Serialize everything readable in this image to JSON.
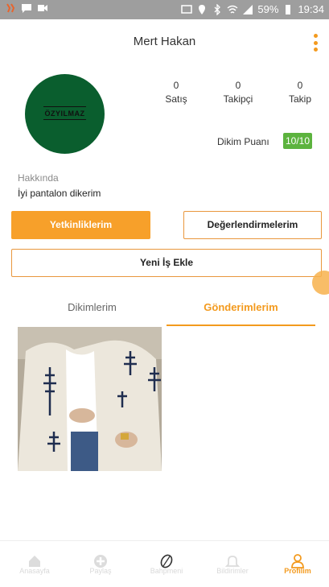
{
  "status_bar": {
    "battery": "59%",
    "time": "19:34"
  },
  "header": {
    "title": "Mert Hakan"
  },
  "profile": {
    "avatar_brand": "ÖZYILMAZ",
    "stats": [
      {
        "value": "0",
        "label": "Satış"
      },
      {
        "value": "0",
        "label": "Takipçi"
      },
      {
        "value": "0",
        "label": "Takip"
      }
    ],
    "dikim_label": "Dikim Puanı",
    "dikim_score": "10/10",
    "about_label": "Hakkında",
    "about_text": "İyi pantalon dikerim"
  },
  "buttons": {
    "yetkinlik": "Yetkinliklerim",
    "degerlendirme": "Değerlendirmelerim",
    "yeni_is": "Yeni İş Ekle"
  },
  "tabs": [
    {
      "label": "Dikimlerim",
      "active": false
    },
    {
      "label": "Gönderimlerim",
      "active": true
    }
  ],
  "bottom_nav": [
    {
      "label": "Anasayfa",
      "icon": "home-icon",
      "active": false
    },
    {
      "label": "Paylaş",
      "icon": "plus-icon",
      "active": false
    },
    {
      "label": "Bahpmeni",
      "icon": "thread-icon",
      "active": false
    },
    {
      "label": "Bildirimler",
      "icon": "bell-icon",
      "active": false
    },
    {
      "label": "Profilim",
      "icon": "person-icon",
      "active": true
    }
  ],
  "colors": {
    "accent": "#f39a1e",
    "score_bg": "#5cb33e",
    "avatar_bg": "#0a5e2e",
    "status_bar": "#9e9e9e"
  }
}
